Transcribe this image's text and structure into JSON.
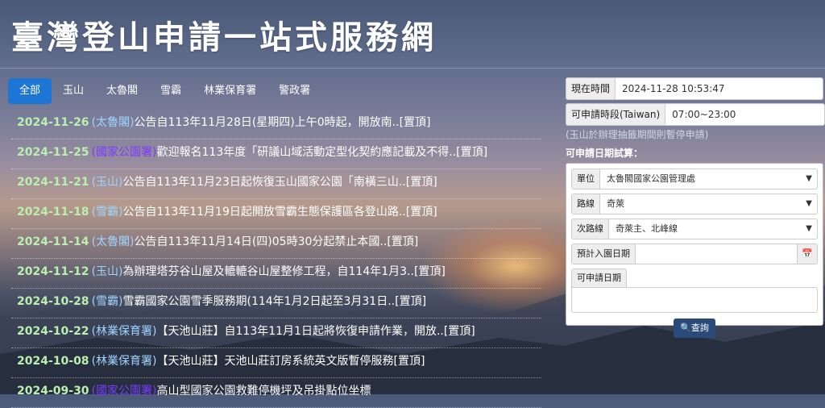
{
  "site": {
    "title": "臺灣登山申請一站式服務網"
  },
  "tabs": [
    {
      "label": "全部",
      "active": true
    },
    {
      "label": "玉山"
    },
    {
      "label": "太魯閣"
    },
    {
      "label": "雪霸"
    },
    {
      "label": "林業保育署"
    },
    {
      "label": "警政署"
    }
  ],
  "news": [
    {
      "date": "2024-11-26",
      "unit": "(太魯閣)",
      "text": "公告自113年11月28日(星期四)上午0時起，開放南..",
      "top": "[置頂]"
    },
    {
      "date": "2024-11-25",
      "unit": "(國家公園署)",
      "text": "歡迎報名113年度「研議山域活動定型化契約應記載及不得..",
      "top": "[置頂]"
    },
    {
      "date": "2024-11-21",
      "unit": "(玉山)",
      "text": "公告自113年11月23日起恢復玉山國家公園「南橫三山..",
      "top": "[置頂]"
    },
    {
      "date": "2024-11-18",
      "unit": "(雪霸)",
      "text": "公告自113年11月19日起開放雪霸生態保護區各登山路..",
      "top": "[置頂]"
    },
    {
      "date": "2024-11-14",
      "unit": "(太魯閣)",
      "text": "公告自113年11月14日(四)05時30分起禁止本國..",
      "top": "[置頂]"
    },
    {
      "date": "2024-11-12",
      "unit": "(玉山)",
      "text": "為辦理塔芬谷山屋及轆轆谷山屋整修工程，自114年1月3..",
      "top": "[置頂]"
    },
    {
      "date": "2024-10-28",
      "unit": "(雪霸)",
      "text": "雪霸國家公園雪季服務期(114年1月2日起至3月31日..",
      "top": "[置頂]"
    },
    {
      "date": "2024-10-22",
      "unit": "(林業保育署)",
      "text": "【天池山莊】自113年11月1日起將恢復申請作業，開放..",
      "top": "[置頂]"
    },
    {
      "date": "2024-10-08",
      "unit": "(林業保育署)",
      "text": "【天池山莊】天池山莊訂房系統英文版暫停服務",
      "top": "[置頂]"
    },
    {
      "date": "2024-09-30",
      "unit": "(國家公園署)",
      "text": "高山型國家公園救難停機坪及吊掛點位坐標",
      "top": ""
    }
  ],
  "panel": {
    "current_time_label": "現在時間",
    "current_time_value": "2024-11-28 10:53:47",
    "apply_hours_label": "可申請時段(Taiwan)",
    "apply_hours_value": "07:00~23:00",
    "note": "(玉山於辦理抽籤期間則暫停申請)",
    "calc_title": "可申請日期試算：",
    "unit_label": "單位",
    "unit_value": "太魯閣國家公園管理處",
    "route_label": "路線",
    "route_value": "奇萊",
    "subroute_label": "次路線",
    "subroute_value": "奇萊主、北峰線",
    "entry_date_label": "預計入園日期",
    "entry_date_value": "",
    "avail_label": "可申請日期",
    "query_label": "查詢"
  }
}
